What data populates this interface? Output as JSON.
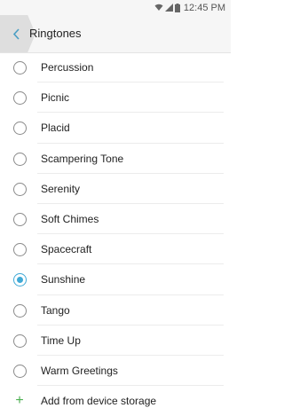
{
  "status_bar": {
    "time": "12:45 PM",
    "icons": [
      "wifi-icon",
      "signal-icon",
      "battery-icon"
    ]
  },
  "header": {
    "title": "Ringtones",
    "back_icon": "chevron-left-icon"
  },
  "ringtones": [
    {
      "label": "Percussion",
      "selected": false
    },
    {
      "label": "Picnic",
      "selected": false
    },
    {
      "label": "Placid",
      "selected": false
    },
    {
      "label": "Scampering Tone",
      "selected": false
    },
    {
      "label": "Serenity",
      "selected": false
    },
    {
      "label": "Soft Chimes",
      "selected": false
    },
    {
      "label": "Spacecraft",
      "selected": false
    },
    {
      "label": "Sunshine",
      "selected": true
    },
    {
      "label": "Tango",
      "selected": false
    },
    {
      "label": "Time Up",
      "selected": false
    },
    {
      "label": "Warm Greetings",
      "selected": false
    }
  ],
  "add_item": {
    "label": "Add from device storage",
    "icon": "plus-icon"
  },
  "colors": {
    "accent": "#3fa9d6",
    "add_icon": "#4caf50"
  }
}
